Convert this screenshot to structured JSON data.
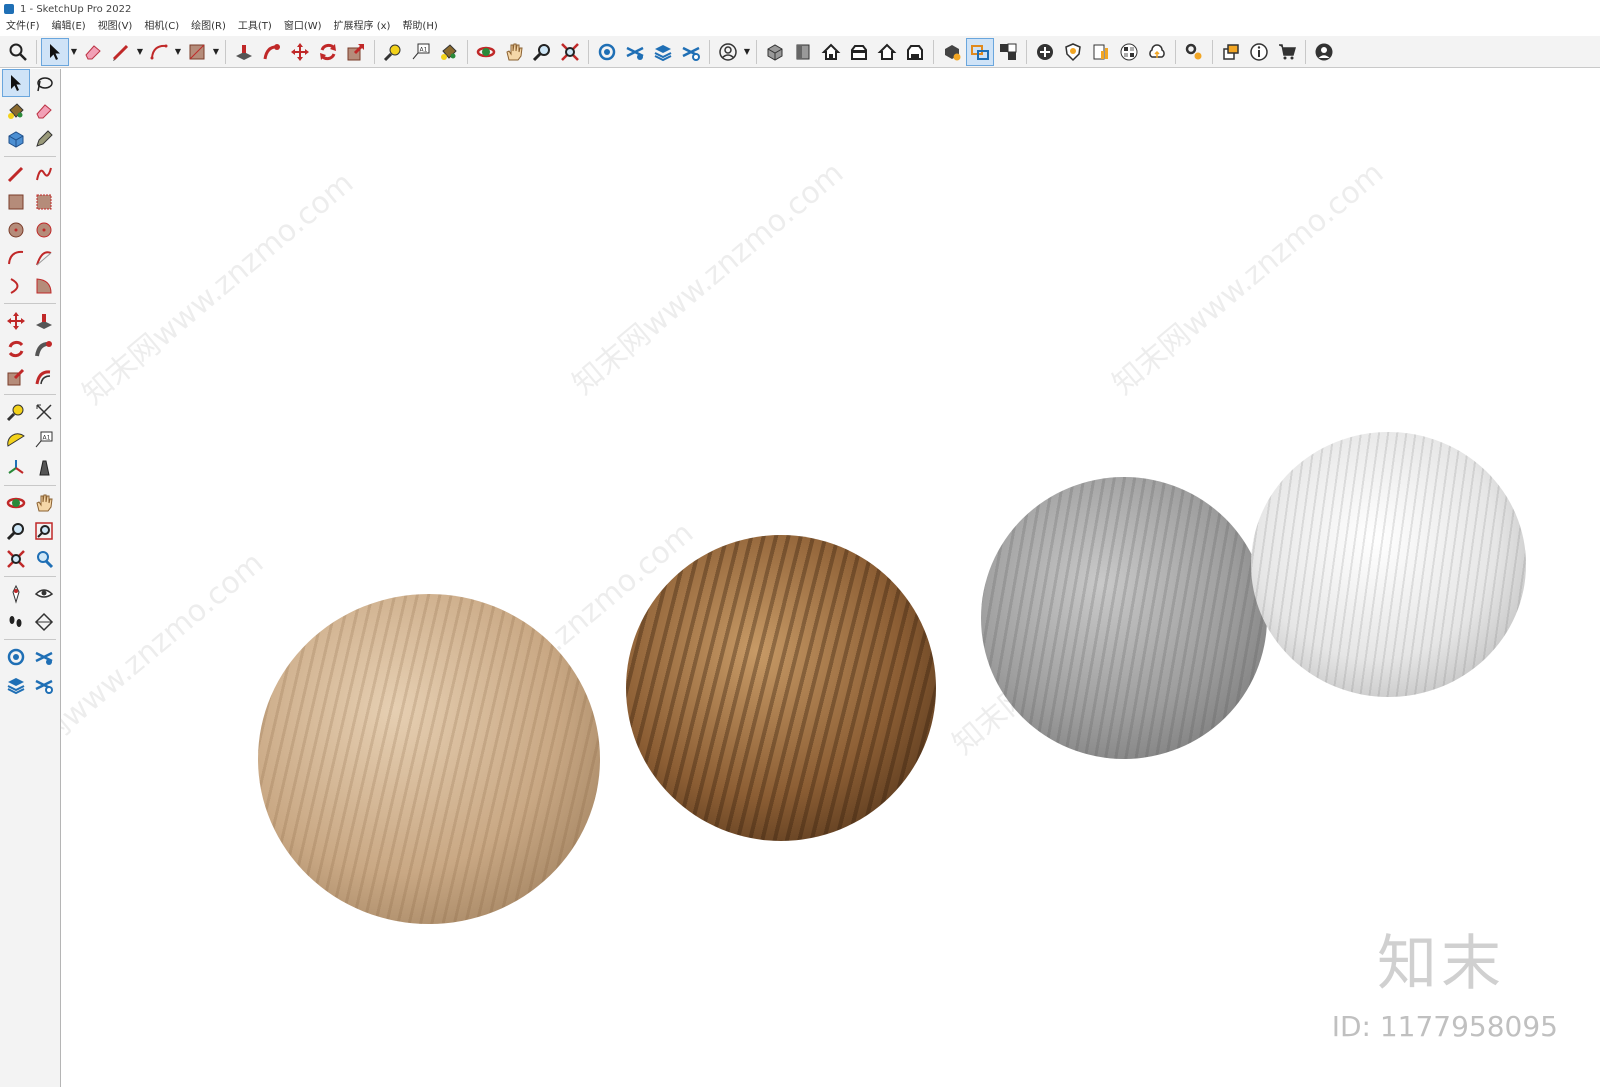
{
  "window": {
    "title": "1 - SketchUp Pro 2022"
  },
  "menu": [
    "文件(F)",
    "编辑(E)",
    "视图(V)",
    "相机(C)",
    "绘图(R)",
    "工具(T)",
    "窗口(W)",
    "扩展程序 (x)",
    "帮助(H)"
  ],
  "watermark": {
    "text": "知末网www.znzmo.com",
    "brand": "知末",
    "id_label": "ID: 1177958095"
  },
  "colors": {
    "accent": "#1f6fb5",
    "tool_red": "#d0322d",
    "selected_bg": "#cfe3f7"
  }
}
